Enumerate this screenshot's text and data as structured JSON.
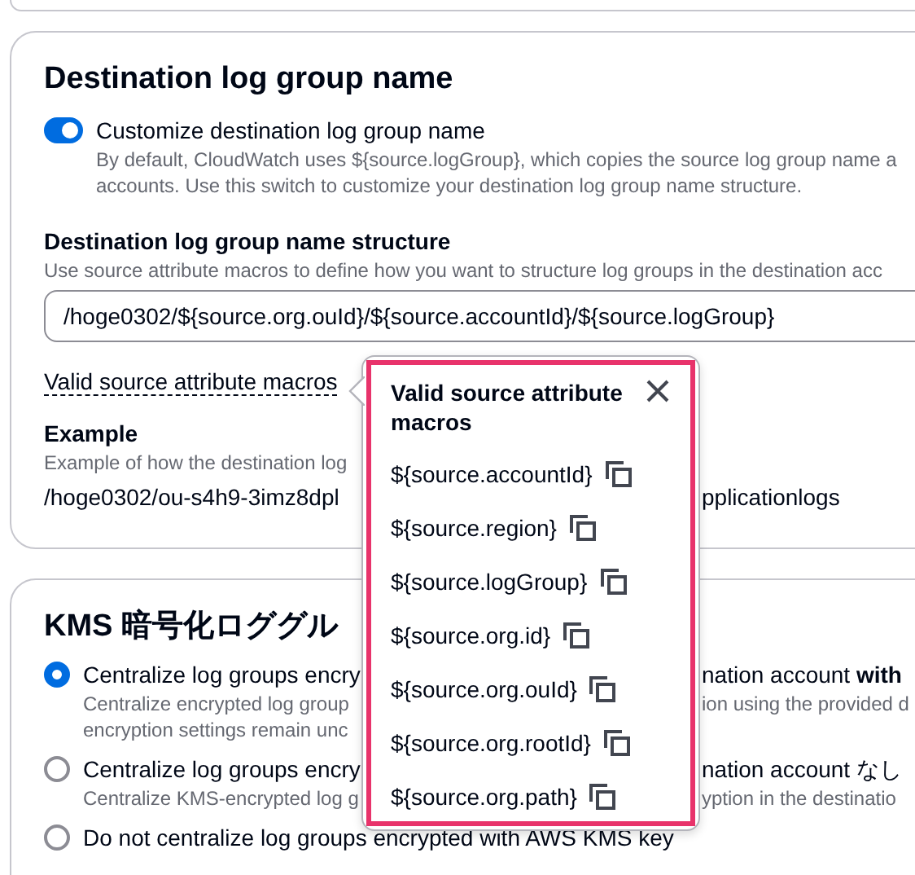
{
  "destination_section": {
    "title": "Destination log group name",
    "toggle": {
      "label": "Customize destination log group name",
      "on": true,
      "description_lines": [
        "By default, CloudWatch uses ${source.logGroup}, which copies the source log group name a",
        "accounts. Use this switch to customize your destination log group name structure."
      ]
    },
    "structure": {
      "label": "Destination log group name structure",
      "description": "Use source attribute macros to define how you want to structure log groups in the destination acc",
      "value": "/hoge0302/${source.org.ouId}/${source.accountId}/${source.logGroup}"
    },
    "macros_link": "Valid source attribute macros",
    "example": {
      "label": "Example",
      "description": "Example of how the destination log",
      "value_left": "/hoge0302/ou-s4h9-3imz8dpl",
      "value_right": "pplicationlogs"
    }
  },
  "kms_section": {
    "title": "KMS 暗号化ロググル",
    "options": [
      {
        "label_left": "Centralize log groups encry",
        "label_right": "nation account **with**",
        "selected": true,
        "description_lines": [
          {
            "left": "Centralize encrypted log group",
            "right": "ion using the provided d"
          },
          {
            "left": "encryption settings remain unc"
          }
        ]
      },
      {
        "label_left": "Centralize log groups encry",
        "label_right": "nation account なし",
        "selected": false,
        "description_lines": [
          {
            "left": "Centralize KMS-encrypted log g",
            "right": "yption in the destinatio"
          }
        ]
      },
      {
        "label_left": "Do not centralize log groups encrypted with AWS KMS key",
        "selected": false
      }
    ]
  },
  "popover": {
    "title": "Valid source attribute macros",
    "macros": [
      "${source.accountId}",
      "${source.region}",
      "${source.logGroup}",
      "${source.org.id}",
      "${source.org.ouId}",
      "${source.org.rootId}",
      "${source.org.path}"
    ]
  }
}
